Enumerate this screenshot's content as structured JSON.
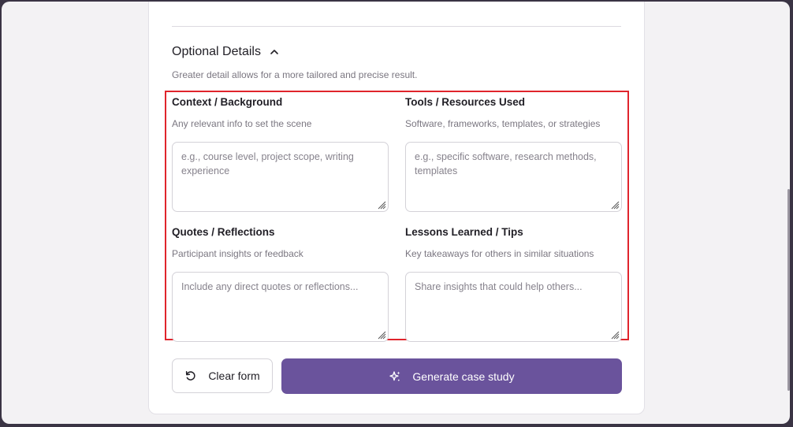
{
  "section": {
    "title": "Optional Details",
    "description": "Greater detail allows for a more tailored and precise result.",
    "toggle_icon": "chevron-up-icon"
  },
  "fields": [
    {
      "label": "Context / Background",
      "help": "Any relevant info to set the scene",
      "placeholder": "e.g., course level, project scope, writing experience",
      "value": ""
    },
    {
      "label": "Tools / Resources Used",
      "help": "Software, frameworks, templates, or strategies",
      "placeholder": "e.g., specific software, research methods, templates",
      "value": ""
    },
    {
      "label": "Quotes / Reflections",
      "help": "Participant insights or feedback",
      "placeholder": "Include any direct quotes or reflections...",
      "value": ""
    },
    {
      "label": "Lessons Learned / Tips",
      "help": "Key takeaways for others in similar situations",
      "placeholder": "Share insights that could help others...",
      "value": ""
    }
  ],
  "actions": {
    "clear_label": "Clear form",
    "clear_icon": "refresh-icon",
    "generate_label": "Generate case study",
    "generate_icon": "sparkle-icon"
  },
  "colors": {
    "accent": "#6a539c",
    "highlight": "#e0242c",
    "background": "#f3f2f4"
  }
}
